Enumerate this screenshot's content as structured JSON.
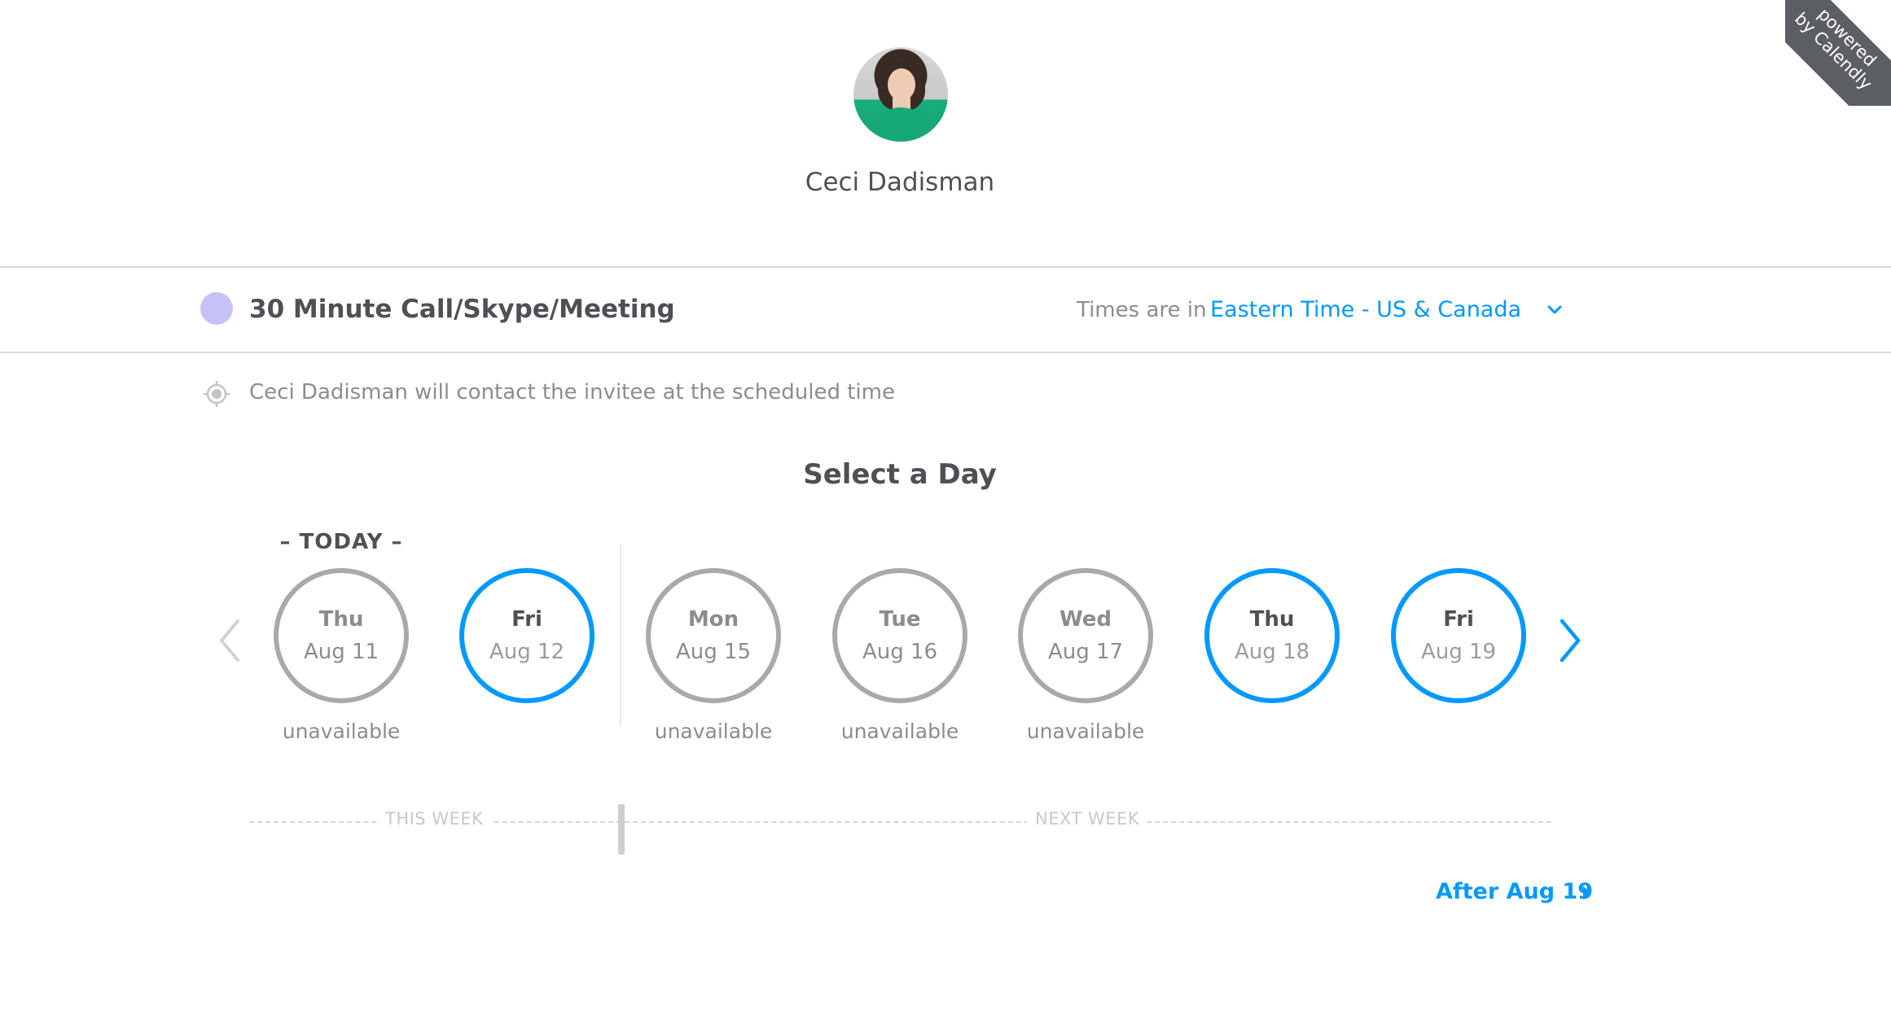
{
  "ribbon": {
    "line1": "powered",
    "line2": "by Calendly"
  },
  "host": {
    "name": "Ceci Dadisman"
  },
  "event": {
    "title": "30 Minute Call/Skype/Meeting",
    "dot_color": "#c5c2f7"
  },
  "timezone": {
    "label": "Times are in",
    "value": "Eastern Time - US & Canada",
    "icon": "chevron-down-icon"
  },
  "location": {
    "icon": "target-icon",
    "text": "Ceci Dadisman will contact the invitee at the scheduled time"
  },
  "picker": {
    "title": "Select a Day",
    "today_label": "– TODAY –",
    "days": [
      {
        "dow": "Thu",
        "date": "Aug 11",
        "status": "unavailable",
        "available": false
      },
      {
        "dow": "Fri",
        "date": "Aug 12",
        "status": "",
        "available": true
      },
      {
        "dow": "Mon",
        "date": "Aug 15",
        "status": "unavailable",
        "available": false
      },
      {
        "dow": "Tue",
        "date": "Aug 16",
        "status": "unavailable",
        "available": false
      },
      {
        "dow": "Wed",
        "date": "Aug 17",
        "status": "unavailable",
        "available": false
      },
      {
        "dow": "Thu",
        "date": "Aug 18",
        "status": "",
        "available": true
      },
      {
        "dow": "Fri",
        "date": "Aug 19",
        "status": "",
        "available": true
      }
    ],
    "this_week_label": "THIS WEEK",
    "next_week_label": "NEXT WEEK",
    "after_link": "After Aug 19"
  },
  "colors": {
    "accent": "#0099ff",
    "unavailable_border": "#a9a9a9",
    "text": "#4d5055",
    "muted": "#8a8c90"
  }
}
